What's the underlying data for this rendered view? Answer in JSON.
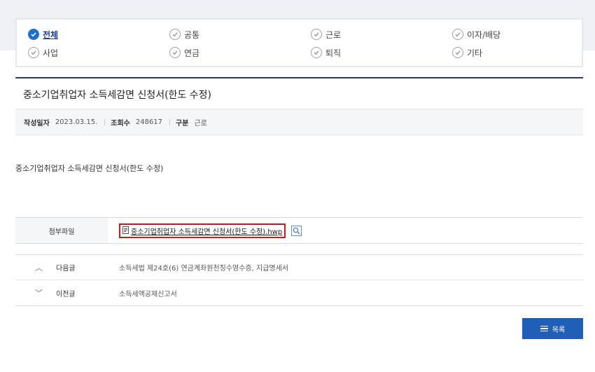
{
  "filters": [
    {
      "label": "전체",
      "active": true
    },
    {
      "label": "공통",
      "active": false
    },
    {
      "label": "근로",
      "active": false
    },
    {
      "label": "이자/배당",
      "active": false
    },
    {
      "label": "사업",
      "active": false
    },
    {
      "label": "연금",
      "active": false
    },
    {
      "label": "퇴직",
      "active": false
    },
    {
      "label": "기타",
      "active": false
    }
  ],
  "post": {
    "title": "중소기업취업자 소득세감면 신청서(한도 수정)",
    "meta": {
      "date_label": "작성일자",
      "date_value": "2023.03.15.",
      "views_label": "조회수",
      "views_value": "248617",
      "category_label": "구분",
      "category_value": "근로"
    },
    "body": "중소기업취업자 소득세감면 신청서(한도 수정)",
    "attachment": {
      "label": "첨부파일",
      "file_name": "중소기업취업자 소득세감면 신청서(한도 수정).hwp"
    }
  },
  "navigation": {
    "next": {
      "arrow": "︿",
      "label": "다음글",
      "title": "소득세법 제24호(6) 연금계좌원천징수영수증, 지급명세서"
    },
    "prev": {
      "arrow": "﹀",
      "label": "이전글",
      "title": "소득세액공제신고서"
    }
  },
  "list_button": {
    "label": "목록"
  },
  "colors": {
    "accent": "#1f6fd1",
    "button": "#1f5fb8",
    "highlight_border": "#d0161b",
    "title_rule": "#2a3a55"
  }
}
